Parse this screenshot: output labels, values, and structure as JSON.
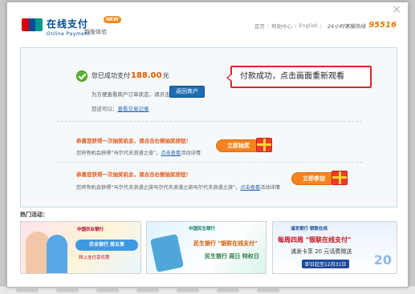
{
  "header": {
    "brand_cn": "在线支付",
    "brand_en": "Online Payment",
    "edition": "新版体验",
    "new_badge": "NEW",
    "nav": [
      "首页",
      "帮助中心",
      "English"
    ],
    "hotline_label": "24小时客服热线",
    "hotline_number": "95516"
  },
  "close_label": "×",
  "success": {
    "prefix": "您已成功支付",
    "amount": "188.00",
    "unit": "元",
    "return_text": "为方便查看商户订单状态，请点击",
    "return_button": "返回商户",
    "more_prefix": "您还可以：",
    "more_link": "查看交易记录"
  },
  "callout": {
    "text": "付款成功，点击画面重新观看"
  },
  "promos": [
    {
      "title": "恭喜您获得一次抽奖机会，请点击右侧抽奖按钮！",
      "desc_prefix": "您将有机会获得“马尔代夫浪漫之旅”，",
      "link": "点击查看",
      "desc_suffix": "活动详情",
      "button": "立即抽奖"
    },
    {
      "title": "恭喜您获得一次抽奖机会，请点击右侧抽奖按钮！",
      "desc_prefix": "您将有机会获得“马尔代夫浪漫之旅马尔代夫浪漫之旅马尔代夫浪漫之旅”，",
      "link": "点击查看",
      "desc_suffix": "活动详情",
      "button": "立即参加"
    }
  ],
  "hot": {
    "label": "热门活动："
  },
  "banners": [
    {
      "bank": "中国农业银行",
      "headline": "农业银行 周五享",
      "sub": "网上支付享优惠"
    },
    {
      "bank": "中国民生银行",
      "line1": "民生银行 \"银联在线支付\"",
      "line2": "民生银行 周日 特权日"
    },
    {
      "bank": "浦发银行 银联在线",
      "line1": "每周四周 \"银联在线支付\"",
      "line2": "浦发卡享 20 元话费赠送",
      "line3": "即日起至12月31日",
      "big": "20"
    }
  ]
}
